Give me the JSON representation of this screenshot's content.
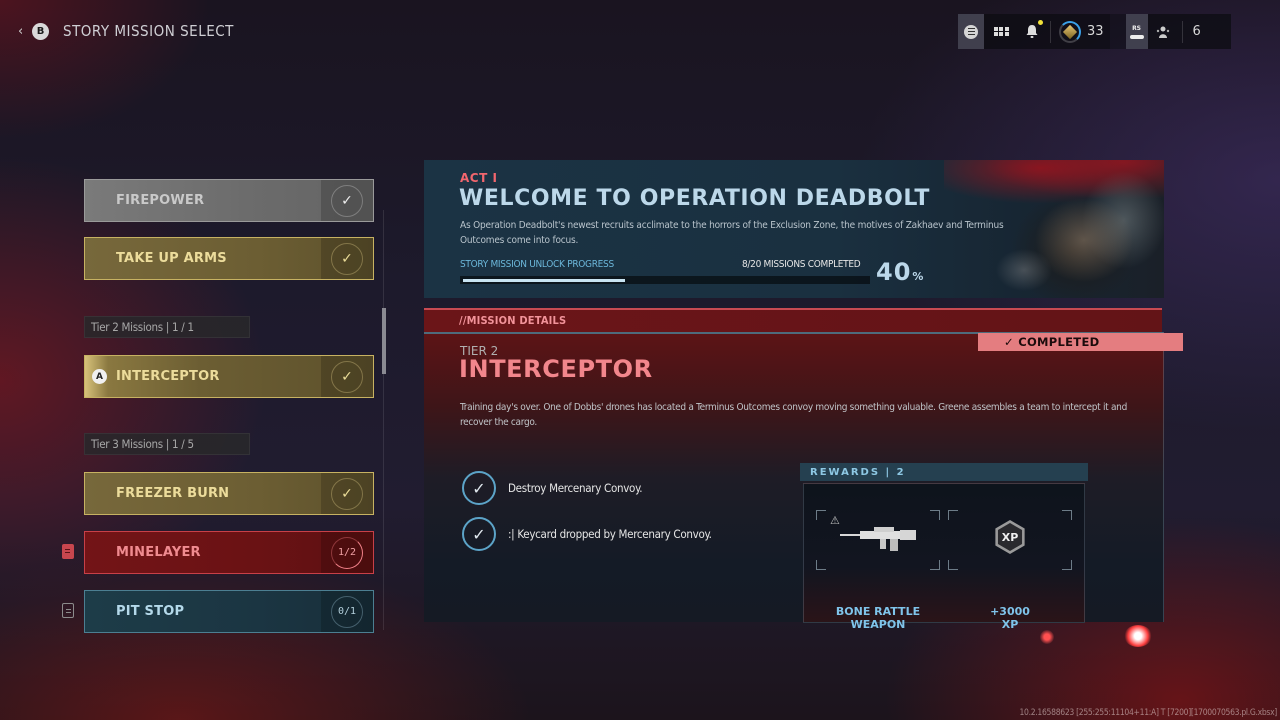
{
  "header": {
    "back_button_glyph": "B",
    "title": "STORY MISSION SELECT",
    "rank_level": "33",
    "party_count": "6",
    "rs_label": "RS",
    "icons": [
      "menu-icon",
      "grid-icon",
      "notification-bell-icon",
      "rank-icon",
      "rs-button-icon",
      "party-icon"
    ]
  },
  "mission_list": {
    "items": [
      {
        "type": "mission",
        "label": "FIREPOWER",
        "style": "grey",
        "status": "completed"
      },
      {
        "type": "mission",
        "label": "TAKE UP ARMS",
        "style": "gold",
        "status": "completed"
      },
      {
        "type": "tier",
        "label": "Tier 2 Missions | 1 / 1"
      },
      {
        "type": "mission",
        "label": "INTERCEPTOR",
        "style": "gold",
        "status": "completed",
        "selected": true,
        "button_glyph": "A"
      },
      {
        "type": "tier",
        "label": "Tier 3 Missions | 1 / 5"
      },
      {
        "type": "mission",
        "label": "FREEZER BURN",
        "style": "gold",
        "status": "completed"
      },
      {
        "type": "mission",
        "label": "MINELAYER",
        "style": "red",
        "status": "in-progress",
        "progress": "1/2"
      },
      {
        "type": "mission",
        "label": "PIT STOP",
        "style": "teal",
        "status": "in-progress",
        "progress": "0/1"
      }
    ]
  },
  "act": {
    "label": "ACT I",
    "title": "WELCOME TO OPERATION DEADBOLT",
    "description": "As Operation Deadbolt's newest recruits acclimate to the horrors of the Exclusion Zone, the motives of Zakhaev and Terminus Outcomes come into focus.",
    "progress_label": "STORY MISSION UNLOCK PROGRESS",
    "missions_completed_text": "8/20 MISSIONS COMPLETED",
    "progress_percent": 40,
    "progress_percent_text": "40",
    "percent_sign": "%"
  },
  "mission_details": {
    "section_label": "//MISSION DETAILS",
    "status_badge": "✓ COMPLETED",
    "tier": "TIER 2",
    "title": "INTERCEPTOR",
    "description": "Training day's over. One of Dobbs' drones has located a Terminus Outcomes convoy moving something valuable. Greene assembles a team to intercept it and recover the cargo.",
    "objectives": [
      {
        "text": "Destroy Mercenary Convoy.",
        "completed": true
      },
      {
        "text": ":| Keycard dropped by Mercenary Convoy.",
        "completed": true
      }
    ]
  },
  "rewards": {
    "header": "REWARDS | 2",
    "items": [
      {
        "line1": "BONE RATTLE",
        "line2": "WEAPON",
        "icon": "rifle-icon"
      },
      {
        "line1": "+3000",
        "line2": "XP",
        "icon": "xp-icon",
        "icon_text": "XP"
      }
    ]
  },
  "debug_footer": "10.2.16588623 [255:255:11104+11:A] T [7200][1700070563.pl.G.xbsx]",
  "colors": {
    "accent_red": "#f2868c",
    "accent_blue": "#bcd8ea",
    "gold": "#ecdc9b",
    "completed_badge": "#e47d80"
  }
}
